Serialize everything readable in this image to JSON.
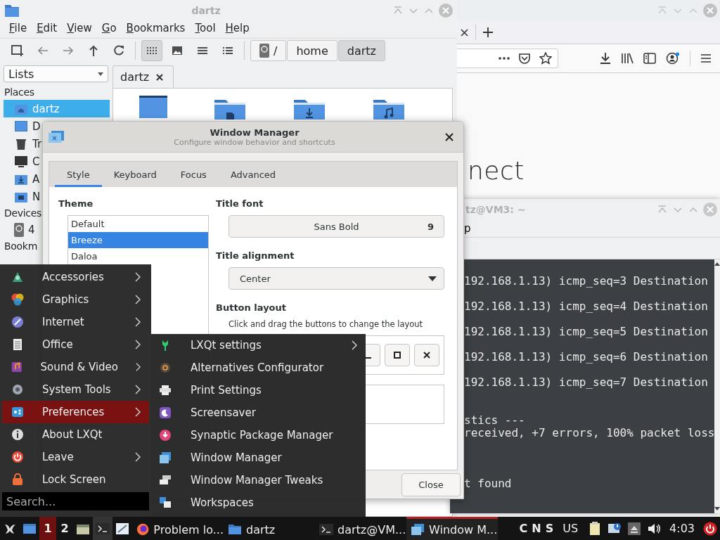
{
  "file_manager": {
    "title": "dartz",
    "menu": [
      "File",
      "Edit",
      "View",
      "Go",
      "Bookmarks",
      "Tool",
      "Help"
    ],
    "view_modes": [
      {
        "selected": true
      },
      {
        "selected": false
      },
      {
        "selected": false
      },
      {
        "selected": false
      }
    ],
    "path": [
      {
        "label": "/",
        "selected": false
      },
      {
        "label": "home",
        "selected": false
      },
      {
        "label": "dartz",
        "selected": true
      }
    ],
    "side_pane": "Lists",
    "tabs": [
      {
        "label": "dartz"
      }
    ],
    "sidebar": [
      {
        "title": "Places",
        "items": [
          {
            "label": "dartz",
            "selected": true
          },
          {
            "label": "D",
            "selected": false
          },
          {
            "label": "Tr",
            "selected": false
          },
          {
            "label": "C",
            "selected": false
          },
          {
            "label": "A",
            "selected": false
          },
          {
            "label": "N",
            "selected": false
          }
        ]
      },
      {
        "title": "Devices",
        "items": [
          {
            "label": "4",
            "selected": false
          }
        ]
      },
      {
        "title": "Bookm"
      }
    ]
  },
  "browser": {
    "heading": "nect"
  },
  "terminal": {
    "title": "tz@VM3: ~",
    "menu": [
      "p"
    ],
    "lines": [
      {
        "kind": "reply",
        "text": "192.168.1.13) icmp_seq=3 Destination"
      },
      {
        "kind": "reply",
        "text": "192.168.1.13) icmp_seq=4 Destination"
      },
      {
        "kind": "reply",
        "text": "192.168.1.13) icmp_seq=5 Destination"
      },
      {
        "kind": "reply",
        "text": "192.168.1.13) icmp_seq=6 Destination"
      },
      {
        "kind": "reply",
        "text": "192.168.1.13) icmp_seq=7 Destination"
      },
      {
        "kind": "stats_head",
        "text": "stics ---"
      },
      {
        "kind": "stats",
        "text": "received, +7 errors, 100% packet loss"
      },
      {
        "kind": "error",
        "text": "t found"
      }
    ]
  },
  "window_manager": {
    "title": "Window Manager",
    "subtitle": "Configure window behavior and shortcuts",
    "tabs": [
      {
        "label": "Style",
        "selected": true
      },
      {
        "label": "Keyboard",
        "selected": false
      },
      {
        "label": "Focus",
        "selected": false
      },
      {
        "label": "Advanced",
        "selected": false
      }
    ],
    "theme_label": "Theme",
    "themes": [
      {
        "label": "Default",
        "selected": false
      },
      {
        "label": "Breeze",
        "selected": true
      },
      {
        "label": "Daloa",
        "selected": false
      }
    ],
    "title_font_label": "Title font",
    "title_font": {
      "name": "Sans Bold",
      "size": "9"
    },
    "title_alignment_label": "Title alignment",
    "title_alignment": "Center",
    "button_layout_label": "Button layout",
    "button_layout_hint": "Click and drag the buttons to change the layout",
    "close_button": "Close"
  },
  "start_menu": {
    "items": [
      {
        "label": "Accessories",
        "has_submenu": true,
        "selected": false
      },
      {
        "label": "Graphics",
        "has_submenu": true,
        "selected": false
      },
      {
        "label": "Internet",
        "has_submenu": true,
        "selected": false
      },
      {
        "label": "Office",
        "has_submenu": true,
        "selected": false
      },
      {
        "label": "Sound & Video",
        "has_submenu": true,
        "selected": false
      },
      {
        "label": "System Tools",
        "has_submenu": true,
        "selected": false
      },
      {
        "label": "Preferences",
        "has_submenu": true,
        "selected": true
      },
      {
        "label": "About LXQt",
        "has_submenu": false,
        "selected": false
      },
      {
        "label": "Leave",
        "has_submenu": true,
        "selected": false
      },
      {
        "label": "Lock Screen",
        "has_submenu": false,
        "selected": false
      }
    ],
    "search": {
      "placeholder": "Search..."
    },
    "submenu": {
      "items": [
        {
          "label": "LXQt settings",
          "has_submenu": true
        },
        {
          "label": "Alternatives Configurator",
          "has_submenu": false
        },
        {
          "label": "Print Settings",
          "has_submenu": false
        },
        {
          "label": "Screensaver",
          "has_submenu": false
        },
        {
          "label": "Synaptic Package Manager",
          "has_submenu": false
        },
        {
          "label": "Window Manager",
          "has_submenu": false
        },
        {
          "label": "Window Manager Tweaks",
          "has_submenu": false
        },
        {
          "label": "Workspaces",
          "has_submenu": false
        }
      ]
    }
  },
  "taskbar": {
    "workspaces": [
      {
        "label": "1",
        "selected": true
      },
      {
        "label": "2",
        "selected": false
      }
    ],
    "tasks": [
      {
        "label": "Problem lo...",
        "active": false
      },
      {
        "label": "dartz",
        "active": false
      },
      {
        "label": "dartz@VM...",
        "active": false
      },
      {
        "label": "Window M...",
        "active": true
      }
    ],
    "lock_keys": [
      "C",
      "N",
      "S"
    ],
    "keyboard_layout": "US",
    "clock": "4:03"
  }
}
